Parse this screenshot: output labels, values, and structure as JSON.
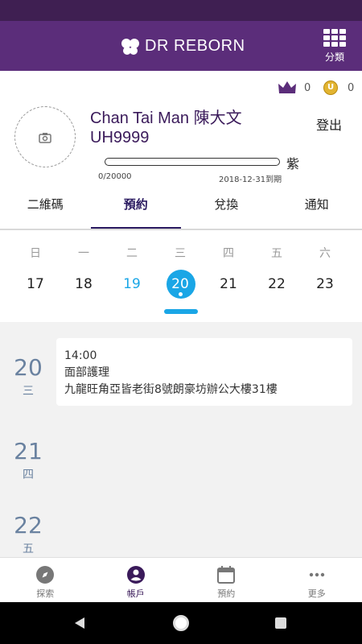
{
  "header": {
    "brand": "DR REBORN",
    "category_label": "分類"
  },
  "profile": {
    "crown_count": "0",
    "coin_count": "0",
    "name": "Chan Tai Man 陳大文",
    "member_id": "UH9999",
    "logout_label": "登出",
    "level": "紫",
    "points": "0/20000",
    "progress": 0,
    "expiry": "2018-12-31到期"
  },
  "tabs": [
    {
      "label": "二維碼"
    },
    {
      "label": "預約"
    },
    {
      "label": "兌換"
    },
    {
      "label": "通知"
    }
  ],
  "calendar": {
    "weekdays": [
      "日",
      "一",
      "二",
      "三",
      "四",
      "五",
      "六"
    ],
    "dates": [
      "17",
      "18",
      "19",
      "20",
      "21",
      "22",
      "23"
    ],
    "today": "19",
    "selected": "20"
  },
  "days": [
    {
      "num": "20",
      "weekday": "三"
    },
    {
      "num": "21",
      "weekday": "四"
    },
    {
      "num": "22",
      "weekday": "五"
    }
  ],
  "appointment": {
    "time": "14:00",
    "service": "面部護理",
    "address": "九龍旺角亞皆老街8號朗豪坊辦公大樓31樓"
  },
  "bottom_nav": [
    {
      "label": "探索",
      "icon": "compass-icon"
    },
    {
      "label": "帳戶",
      "icon": "account-icon"
    },
    {
      "label": "預約",
      "icon": "calendar-icon"
    },
    {
      "label": "更多",
      "icon": "more-icon"
    }
  ],
  "colors": {
    "brand": "#5b2d7a",
    "accent": "#1aa6e6",
    "day_text": "#6a82a0"
  }
}
